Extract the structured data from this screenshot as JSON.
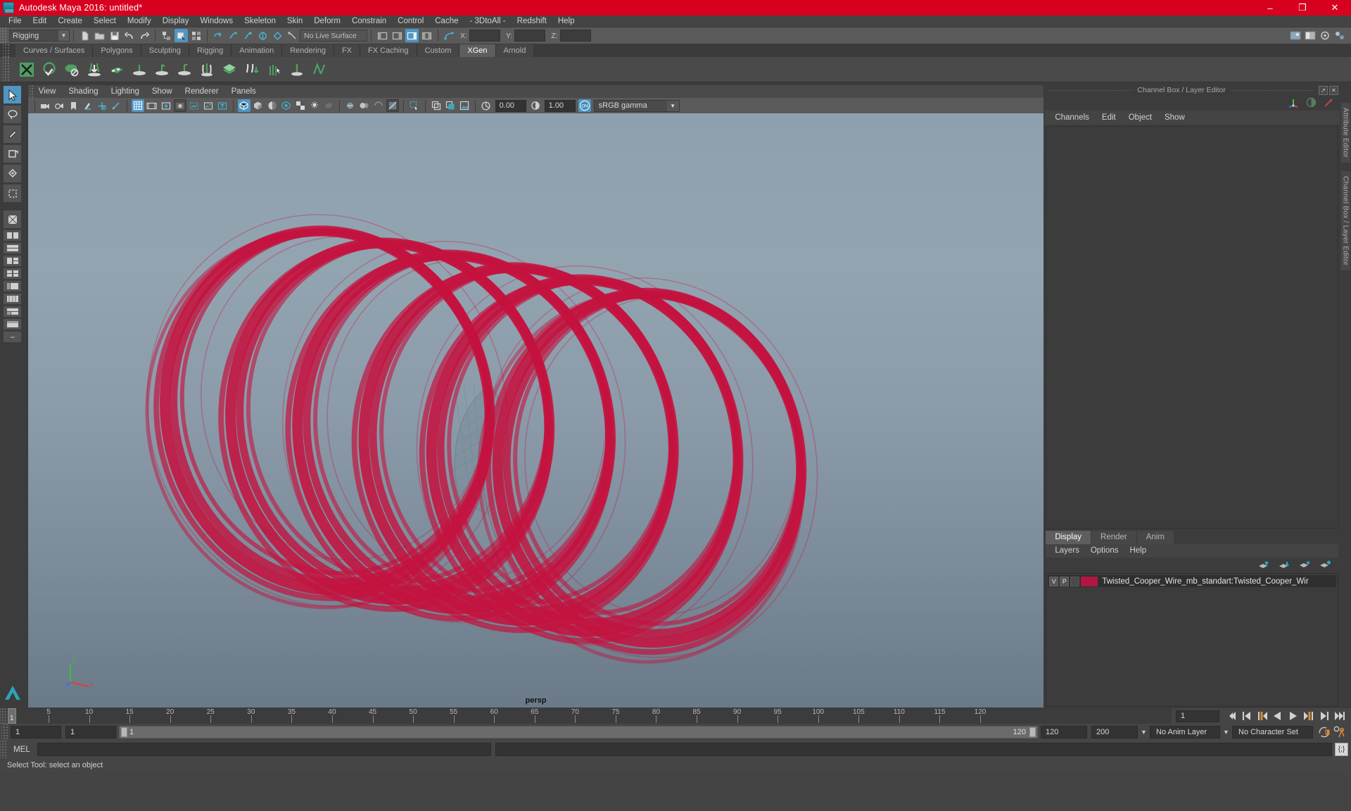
{
  "window": {
    "title": "Autodesk Maya 2016: untitled*",
    "logo": "maya-logo-icon",
    "controls": {
      "minimize": "–",
      "maximize": "❐",
      "close": "✕"
    }
  },
  "menubar": {
    "items": [
      {
        "label": "File"
      },
      {
        "label": "Edit"
      },
      {
        "label": "Create"
      },
      {
        "label": "Select"
      },
      {
        "label": "Modify"
      },
      {
        "label": "Display"
      },
      {
        "label": "Windows"
      },
      {
        "label": "Skeleton"
      },
      {
        "label": "Skin"
      },
      {
        "label": "Deform"
      },
      {
        "label": "Constrain"
      },
      {
        "label": "Control"
      },
      {
        "label": "Cache"
      },
      {
        "label": "- 3DtoAll -"
      },
      {
        "label": "Redshift"
      },
      {
        "label": "Help"
      }
    ]
  },
  "statusbar": {
    "menu_set": "Rigging",
    "live_surface": "No Live Surface",
    "coords": {
      "x_label": "X:",
      "x_value": "",
      "y_label": "Y:",
      "y_value": "",
      "z_label": "Z:",
      "z_value": ""
    }
  },
  "shelf": {
    "tabs": [
      {
        "label": "Curves / Surfaces",
        "selected": false
      },
      {
        "label": "Polygons",
        "selected": false
      },
      {
        "label": "Sculpting",
        "selected": false
      },
      {
        "label": "Rigging",
        "selected": false
      },
      {
        "label": "Animation",
        "selected": false
      },
      {
        "label": "Rendering",
        "selected": false
      },
      {
        "label": "FX",
        "selected": false
      },
      {
        "label": "FX Caching",
        "selected": false
      },
      {
        "label": "Custom",
        "selected": false
      },
      {
        "label": "XGen",
        "selected": true
      },
      {
        "label": "Arnold",
        "selected": false
      }
    ]
  },
  "viewport": {
    "menus": [
      {
        "label": "View"
      },
      {
        "label": "Shading"
      },
      {
        "label": "Lighting"
      },
      {
        "label": "Show"
      },
      {
        "label": "Renderer"
      },
      {
        "label": "Panels"
      }
    ],
    "exposure_value": "0.00",
    "gamma_value": "1.00",
    "color_management": "sRGB gamma",
    "camera_label": "persp",
    "mesh_color": "#c4123f"
  },
  "channel_box": {
    "panel_title": "Channel Box / Layer Editor",
    "menus": [
      {
        "label": "Channels"
      },
      {
        "label": "Edit"
      },
      {
        "label": "Object"
      },
      {
        "label": "Show"
      }
    ]
  },
  "layer_editor": {
    "tabs": [
      {
        "label": "Display",
        "selected": true
      },
      {
        "label": "Render",
        "selected": false
      },
      {
        "label": "Anim",
        "selected": false
      }
    ],
    "menus": [
      {
        "label": "Layers"
      },
      {
        "label": "Options"
      },
      {
        "label": "Help"
      }
    ],
    "layers": [
      {
        "visibility": "V",
        "playback": "P",
        "color": "#b01641",
        "name": "Twisted_Cooper_Wire_mb_standart:Twisted_Cooper_Wir"
      }
    ]
  },
  "dock_tabs": [
    {
      "label": "Attribute Editor"
    },
    {
      "label": "Channel Box / Layer Editor"
    }
  ],
  "timeline": {
    "start": 1,
    "end": 120,
    "current_frame": "1",
    "tick_labels": [
      "5",
      "10",
      "15",
      "20",
      "25",
      "30",
      "35",
      "40",
      "45",
      "50",
      "55",
      "60",
      "65",
      "70",
      "75",
      "80",
      "85",
      "90",
      "95",
      "100",
      "105",
      "110",
      "115",
      "120"
    ],
    "cursor_label": "1"
  },
  "range": {
    "anim_start": "1",
    "playback_start": "1",
    "bar_start_label": "1",
    "bar_end_label": "120",
    "playback_end": "120",
    "anim_end": "200",
    "anim_layer": "No Anim Layer",
    "character_set": "No Character Set"
  },
  "command_line": {
    "language_label": "MEL",
    "input_value": "",
    "output_value": "",
    "script_editor_icon": "{;}"
  },
  "help_line": {
    "text": "Select Tool: select an object"
  },
  "colors": {
    "title_bar": "#d8001f",
    "accent_blue": "#4f96c4",
    "shelf_green": "#4f9f62",
    "transport_orange": "#e08a32"
  }
}
